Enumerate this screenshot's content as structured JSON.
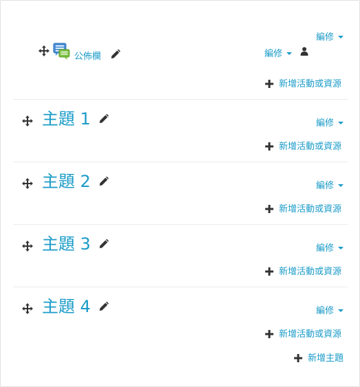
{
  "colors": {
    "link": "#1a9bc8",
    "icon": "#333333",
    "forum_icon_blue": "#4a90d9",
    "forum_icon_green": "#7cc243",
    "divider": "#ececec"
  },
  "announcements": {
    "section_edit": "編修",
    "activity_name": "公佈欄",
    "activity_edit": "編修",
    "add_activity": "新增活動或資源",
    "icons": [
      "move-icon",
      "forum-icon",
      "pencil-icon",
      "user-icon",
      "plus-icon"
    ]
  },
  "topics": [
    {
      "title": "主題 1",
      "edit": "編修",
      "add_activity": "新增活動或資源"
    },
    {
      "title": "主題 2",
      "edit": "編修",
      "add_activity": "新增活動或資源"
    },
    {
      "title": "主題 3",
      "edit": "編修",
      "add_activity": "新增活動或資源"
    },
    {
      "title": "主題 4",
      "edit": "編修",
      "add_activity": "新增活動或資源"
    }
  ],
  "add_topic": "新增主題"
}
